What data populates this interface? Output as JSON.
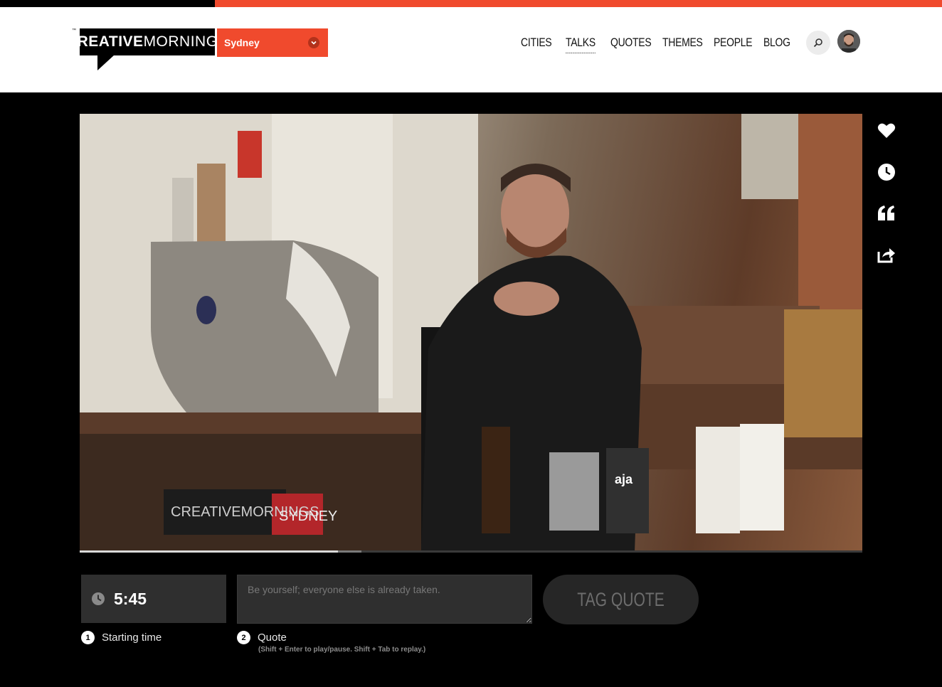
{
  "brand": {
    "trademark": "™",
    "logo_bold": "CREATIVE",
    "logo_light": "MORNINGS"
  },
  "city_select": {
    "value": "Sydney",
    "accent_color": "#f04a2d"
  },
  "nav": {
    "items": [
      {
        "label": "CITIES",
        "active": false
      },
      {
        "label": "TALKS",
        "active": true
      },
      {
        "label": "QUOTES",
        "active": false
      },
      {
        "label": "THEMES",
        "active": false
      },
      {
        "label": "PEOPLE",
        "active": false
      },
      {
        "label": "BLOG",
        "active": false
      }
    ],
    "search_icon": "search-icon",
    "avatar": "user-avatar"
  },
  "video": {
    "played_fraction": 0.33,
    "loaded_fraction": 0.36,
    "scene_signage": {
      "bar_logo_left": "CREATIVEMORNINGS",
      "bar_logo_right": "SYDNEY",
      "cup_label": "aja"
    }
  },
  "side_actions": [
    {
      "name": "heart-icon"
    },
    {
      "name": "clock-icon"
    },
    {
      "name": "quote-icon"
    },
    {
      "name": "share-icon"
    }
  ],
  "quote_form": {
    "time_value": "5:45",
    "quote_placeholder": "Be yourself; everyone else is already taken.",
    "quote_value": "",
    "tag_button_label": "TAG QUOTE",
    "step1_number": "1",
    "step1_label": "Starting time",
    "step2_number": "2",
    "step2_label": "Quote",
    "hint": "(Shift + Enter to play/pause. Shift + Tab to replay.)"
  }
}
